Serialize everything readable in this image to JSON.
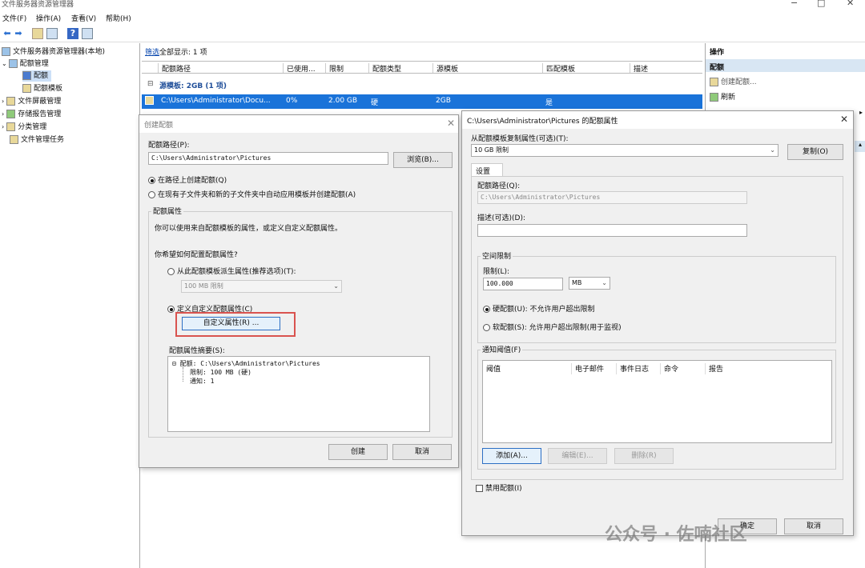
{
  "window": {
    "title": "文件服务器资源管理器",
    "min": "−",
    "max": "□",
    "close": "✕"
  },
  "menu": [
    "文件(F)",
    "操作(A)",
    "查看(V)",
    "帮助(H)"
  ],
  "tree": {
    "root": "文件服务器资源管理器(本地)",
    "quota_mgmt": "配额管理",
    "quota": "配额",
    "quota_template": "配额模板",
    "screen_mgmt": "文件屏蔽管理",
    "report_mgmt": "存储报告管理",
    "classify_mgmt": "分类管理",
    "file_task": "文件管理任务"
  },
  "center": {
    "filter_link": "筛选",
    "filter_text": "全部显示: 1 项",
    "columns": [
      "配额路径",
      "已使用...",
      "限制",
      "配额类型",
      "源模板",
      "匹配模板",
      "描述"
    ],
    "group_label": "源模板: 2GB (1 项)",
    "row": {
      "path": "C:\\Users\\Administrator\\Docu...",
      "used": "0%",
      "limit": "2.00 GB",
      "type": "硬",
      "template": "2GB",
      "match": "是"
    }
  },
  "actions": {
    "header": "操作",
    "sub": "配额",
    "create": "创建配额...",
    "refresh": "刷新"
  },
  "create_dialog": {
    "title": "创建配额",
    "path_label": "配额路径(P):",
    "path_value": "C:\\Users\\Administrator\\Pictures",
    "browse": "浏览(B)...",
    "radio_path": "在路径上创建配额(Q)",
    "radio_auto": "在现有子文件夹和新的子文件夹中自动应用模板并创建配额(A)",
    "props_group": "配额属性",
    "props_desc": "你可以使用来自配额模板的属性，或定义自定义配额属性。",
    "how_label": "你希望如何配置配额属性?",
    "radio_derive": "从此配额模板派生属性(推荐选项)(T):",
    "template_select": "100 MB 限制",
    "radio_custom": "定义自定义配额属性(C)",
    "custom_btn": "自定义属性(R) ...",
    "summary_label": "配额属性摘要(S):",
    "summary_root": "配额: C:\\Users\\Administrator\\Pictures",
    "summary_limit": "限制: 100 MB (硬)",
    "summary_notify": "通知: 1",
    "create_btn": "创建",
    "cancel_btn": "取消"
  },
  "props_dialog": {
    "title": "C:\\Users\\Administrator\\Pictures 的配额属性",
    "copy_label": "从配额模板复制属性(可选)(T):",
    "copy_select": "10 GB 限制",
    "copy_btn": "复制(O)",
    "tab": "设置",
    "path_label": "配额路径(Q):",
    "path_value": "C:\\Users\\Administrator\\Pictures",
    "desc_label": "描述(可选)(D):",
    "space_group": "空间限制",
    "limit_label": "限制(L):",
    "limit_value": "100.000",
    "unit": "MB",
    "hard_radio": "硬配额(U): 不允许用户超出限制",
    "soft_radio": "软配额(S): 允许用户超出限制(用于监视)",
    "notify_group": "通知阈值(F)",
    "notify_cols": [
      "阈值",
      "电子邮件",
      "事件日志",
      "命令",
      "报告"
    ],
    "add_btn": "添加(A)...",
    "edit_btn": "编辑(E)...",
    "delete_btn": "删除(R)",
    "disable_check": "禁用配额(I)",
    "ok_btn": "确定",
    "cancel_btn": "取消"
  },
  "watermark": "公众号 · 佐喃社区"
}
